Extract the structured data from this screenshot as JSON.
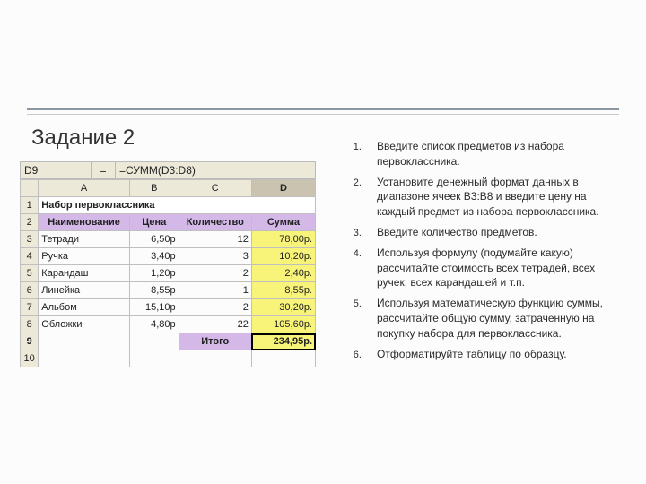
{
  "slide": {
    "title": "Задание 2"
  },
  "formula_bar": {
    "addr": "D9",
    "divider": "=",
    "formula": "=СУММ(D3:D8)"
  },
  "cols": {
    "corner": "",
    "a": "A",
    "b": "B",
    "c": "C",
    "d": "D"
  },
  "rows": {
    "r1": "1",
    "r2": "2",
    "r3": "3",
    "r4": "4",
    "r5": "5",
    "r6": "6",
    "r7": "7",
    "r8": "8",
    "r9": "9",
    "r10": "10"
  },
  "table_title": "Набор первоклассника",
  "headers": {
    "name": "Наименование",
    "price": "Цена",
    "qty": "Количество",
    "sum": "Сумма"
  },
  "items": [
    {
      "name": "Тетради",
      "price": "6,50р",
      "qty": "12",
      "sum": "78,00р."
    },
    {
      "name": "Ручка",
      "price": "3,40р",
      "qty": "3",
      "sum": "10,20р."
    },
    {
      "name": "Карандаш",
      "price": "1,20р",
      "qty": "2",
      "sum": "2,40р."
    },
    {
      "name": "Линейка",
      "price": "8,55р",
      "qty": "1",
      "sum": "8,55р."
    },
    {
      "name": "Альбом",
      "price": "15,10р",
      "qty": "2",
      "sum": "30,20р."
    },
    {
      "name": "Обложки",
      "price": "4,80р",
      "qty": "22",
      "sum": "105,60р."
    }
  ],
  "totals": {
    "label": "Итого",
    "value": "234,95р."
  },
  "instructions": [
    "Введите список предметов из набора первоклассника.",
    "Установите денежный формат данных в диапазоне ячеек В3:В8 и введите цену на каждый предмет из набора первоклассника.",
    "Введите количество предметов.",
    "Используя формулу (подумайте какую) рассчитайте стоимость всех тетрадей, всех ручек, всех карандашей и т.п.",
    "Используя математическую функцию суммы, рассчитайте общую сумму, затраченную на покупку набора для первоклассника.",
    "Отформатируйте таблицу по образцу."
  ]
}
